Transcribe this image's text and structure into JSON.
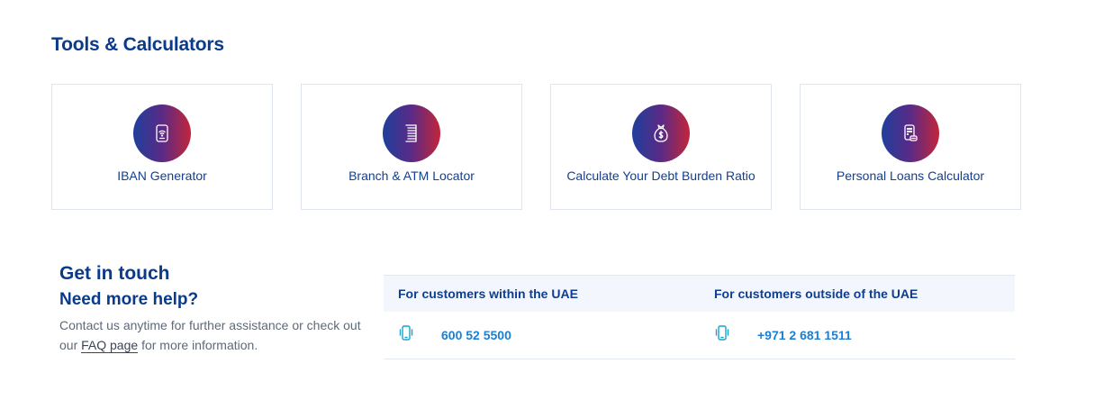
{
  "tools_section": {
    "title": "Tools & Calculators",
    "cards": [
      {
        "label": "IBAN Generator",
        "icon": "card-wireless-icon"
      },
      {
        "label": "Branch & ATM Locator",
        "icon": "atm-icon"
      },
      {
        "label": "Calculate Your Debt Burden Ratio",
        "icon": "money-bag-icon"
      },
      {
        "label": "Personal Loans Calculator",
        "icon": "calculator-icon"
      }
    ],
    "icon_gradient": [
      "#1f3f9c",
      "#c2263b"
    ]
  },
  "contact": {
    "title": "Get in touch",
    "subtitle": "Need more help?",
    "text_before": "Contact us anytime for further assistance or check out our",
    "faq_link": "FAQ page",
    "text_after": "for more information.",
    "headers": {
      "uae": "For customers within the UAE",
      "outside": "For customers outside of the UAE"
    },
    "phones": {
      "uae": "600 52 5500",
      "outside": "+971 2 681 1511"
    },
    "phone_icon": "mobile-phone-icon"
  },
  "colors": {
    "heading": "#0a3a8c",
    "link_blue": "#1a7fd6",
    "phone_icon": "#19a3c9"
  }
}
